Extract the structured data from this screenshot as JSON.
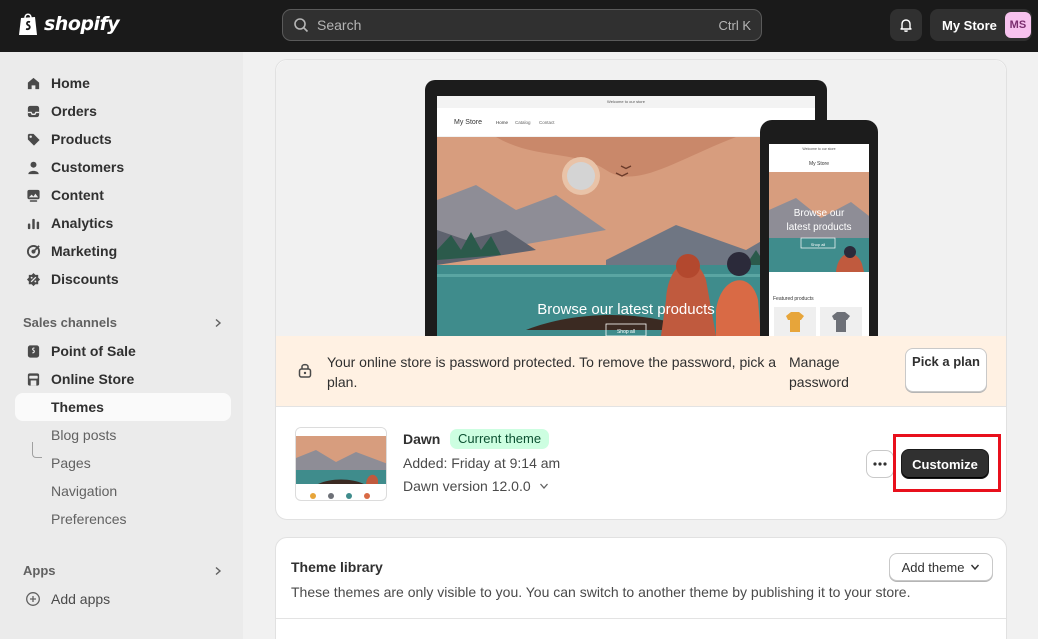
{
  "topbar": {
    "logo_text": "shopify",
    "search_placeholder": "Search",
    "search_shortcut": "Ctrl K",
    "store_name": "My Store",
    "avatar_initials": "MS"
  },
  "sidebar": {
    "items": [
      {
        "label": "Home",
        "icon": "home-icon"
      },
      {
        "label": "Orders",
        "icon": "inbox-icon"
      },
      {
        "label": "Products",
        "icon": "tag-icon"
      },
      {
        "label": "Customers",
        "icon": "person-icon"
      },
      {
        "label": "Content",
        "icon": "image-icon"
      },
      {
        "label": "Analytics",
        "icon": "bar-chart-icon"
      },
      {
        "label": "Marketing",
        "icon": "target-icon"
      },
      {
        "label": "Discounts",
        "icon": "discount-icon"
      }
    ],
    "sales_channels_title": "Sales channels",
    "point_of_sale": "Point of Sale",
    "online_store": "Online Store",
    "subitems": [
      "Themes",
      "Blog posts",
      "Pages",
      "Navigation",
      "Preferences"
    ],
    "apps_title": "Apps",
    "add_apps": "Add apps"
  },
  "preview": {
    "desktop_announcement": "Welcome to our store",
    "desktop_store": "My Store",
    "desktop_nav": [
      "Home",
      "Catalog",
      "Contact"
    ],
    "hero_text": "Browse our latest products",
    "shop_all": "Shop all",
    "mobile_announcement": "Welcome to our store",
    "mobile_store": "My Store",
    "mobile_hero_line1": "Browse our",
    "mobile_hero_line2": "latest products",
    "featured": "Featured products"
  },
  "banner": {
    "text": "Your online store is password protected. To remove the password, pick a plan.",
    "manage_link": "Manage password",
    "pick_plan": "Pick a plan"
  },
  "current_theme": {
    "name": "Dawn",
    "badge": "Current theme",
    "added": "Added: Friday at 9:14 am",
    "version": "Dawn version 12.0.0",
    "customize": "Customize"
  },
  "library": {
    "title": "Theme library",
    "description": "These themes are only visible to you. You can switch to another theme by publishing it to your store.",
    "add_theme": "Add theme"
  },
  "colors": {
    "topbar": "#1a1a1a",
    "banner": "#fff1e3",
    "badge": "#cdfee1",
    "highlight": "#e8101c"
  }
}
